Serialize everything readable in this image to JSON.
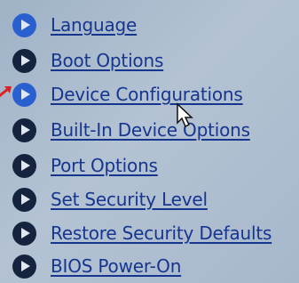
{
  "menu": {
    "items": [
      {
        "label": "Language",
        "bullet": "blue-play-bullet-icon",
        "active": true
      },
      {
        "label": "Boot Options",
        "bullet": "play-bullet-icon",
        "active": false
      },
      {
        "label": "Device Configurations",
        "bullet": "blue-play-bullet-icon",
        "active": true
      },
      {
        "label": "Built-In Device Options",
        "bullet": "play-bullet-icon",
        "active": false
      },
      {
        "label": "Port Options",
        "bullet": "play-bullet-icon",
        "active": false
      },
      {
        "label": "Set Security Level",
        "bullet": "play-bullet-icon",
        "active": false
      },
      {
        "label": "Restore Security Defaults",
        "bullet": "play-bullet-icon",
        "active": false
      },
      {
        "label": "BIOS Power-On",
        "bullet": "play-bullet-icon",
        "active": false
      }
    ]
  },
  "colors": {
    "background": "#a9bbce",
    "link_text": "#16358f",
    "bullet_dark": "#16233f",
    "bullet_blue": "#2a5fd0",
    "pointer_arrow": "#e02020"
  },
  "overlays": {
    "pointer_arrow": "red-arrow-icon",
    "mouse_cursor": "mouse-cursor-icon"
  }
}
